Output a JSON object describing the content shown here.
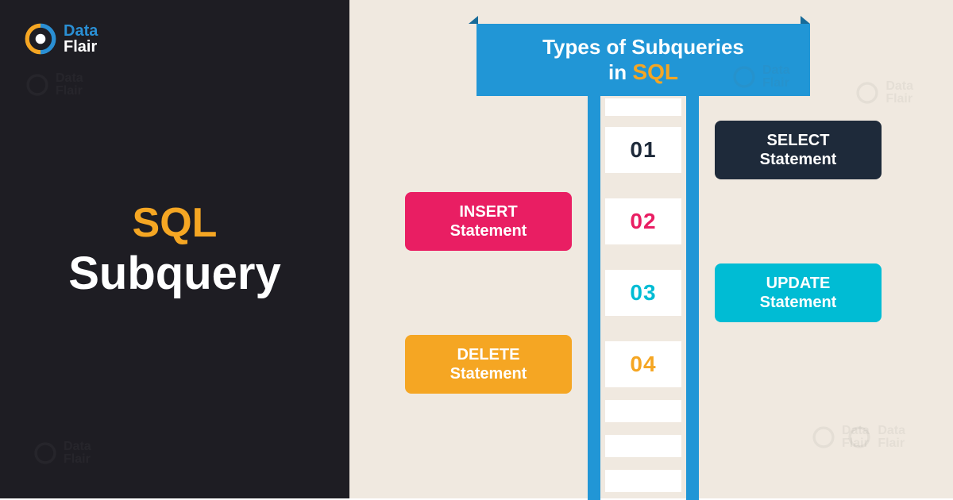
{
  "brand": {
    "word1": "Data",
    "word2": "Flair"
  },
  "left": {
    "title_accent": "SQL",
    "title_main": "Subquery"
  },
  "header": {
    "line1": "Types of Subqueries",
    "line2_prefix": "in ",
    "line2_accent": "SQL"
  },
  "items": [
    {
      "num": "01",
      "title": "SELECT",
      "sub": "Statement",
      "side": "right",
      "color": "#1e2a3a"
    },
    {
      "num": "02",
      "title": "INSERT",
      "sub": "Statement",
      "side": "left",
      "color": "#e91e63"
    },
    {
      "num": "03",
      "title": "UPDATE",
      "sub": "Statement",
      "side": "right",
      "color": "#00bcd4"
    },
    {
      "num": "04",
      "title": "DELETE",
      "sub": "Statement",
      "side": "left",
      "color": "#f5a623"
    }
  ]
}
